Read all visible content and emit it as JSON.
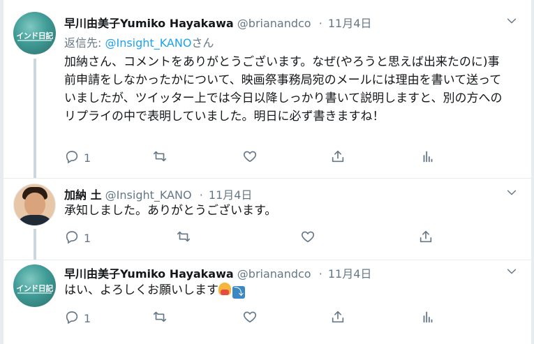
{
  "tweets": [
    {
      "display_name": "早川由美子Yumiko Hayakawa",
      "handle": "@brianandco",
      "separator": "·",
      "date": "11月4日",
      "avatar_text": "インド日記",
      "reply_prefix": "返信先: ",
      "reply_mention": "@Insight_KANO",
      "reply_suffix": "さん",
      "text": "加納さん、コメントをありがとうございます。なぜ(やろうと思えば出来たのに)事前申請をしなかったかについて、映画祭事務局宛のメールには理由を書いて送っていましたが、ツイッター上では今日以降しっかり書いて説明しますと、別の方へのリプライの中で表明していました。明日に必ず書きますね！",
      "reply_count": "1"
    },
    {
      "display_name": "加納 土",
      "handle": "@Insight_KANO",
      "separator": "·",
      "date": "11月4日",
      "text": "承知しました。ありがとうございます。",
      "reply_count": "1"
    },
    {
      "display_name": "早川由美子Yumiko Hayakawa",
      "handle": "@brianandco",
      "separator": "·",
      "date": "11月4日",
      "avatar_text": "インド日記",
      "text": "はい、よろしくお願いします",
      "reply_count": "1"
    }
  ],
  "icons": {
    "reply": "reply-icon",
    "retweet": "retweet-icon",
    "like": "heart-icon",
    "share": "share-icon",
    "analytics": "analytics-icon",
    "more": "chevron-down-icon"
  },
  "colors": {
    "link": "#1da1f2",
    "secondary_text": "#657786",
    "thread_line": "#ccd6dd"
  }
}
